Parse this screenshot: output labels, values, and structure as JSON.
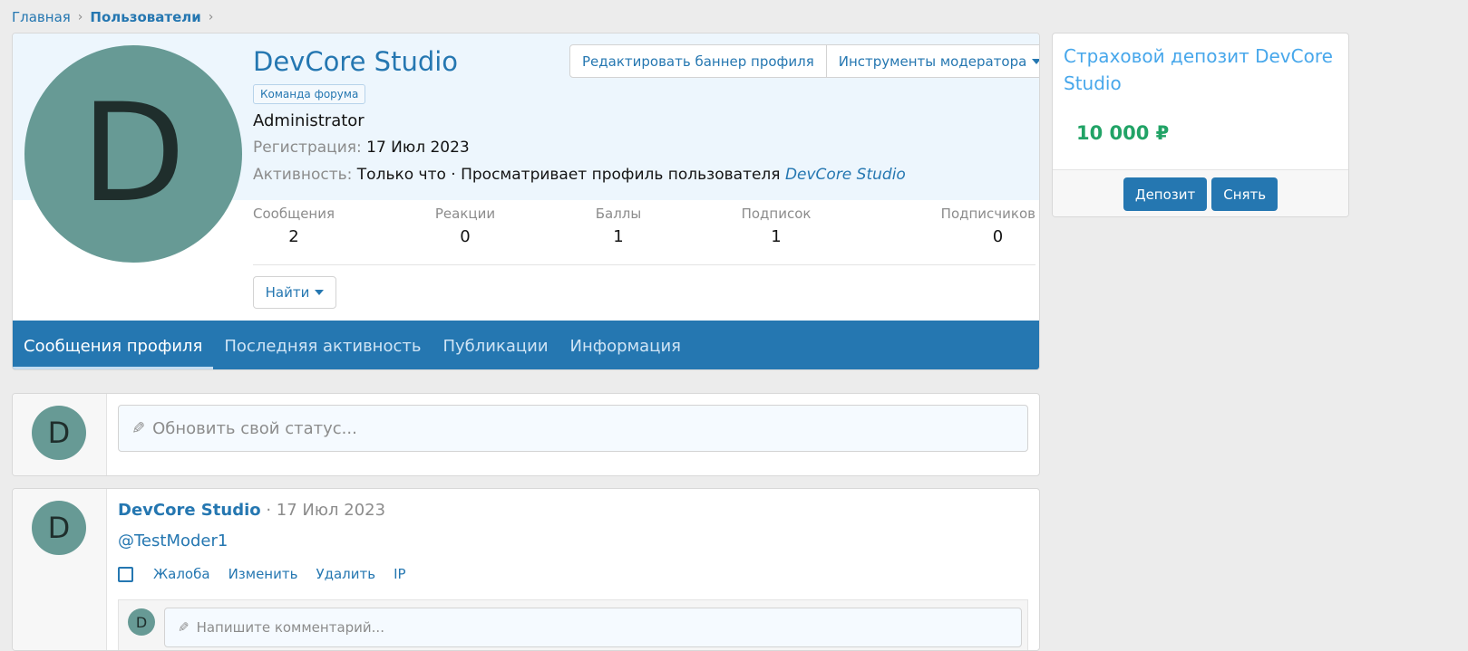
{
  "breadcrumb": {
    "home": "Главная",
    "current": "Пользователи",
    "separator": "›"
  },
  "profile": {
    "avatar_letter": "D",
    "name": "DevCore Studio",
    "banner": "Команда форума",
    "role": "Administrator",
    "registration_label": "Регистрация:",
    "registration_value": "17 Июл 2023",
    "activity_label": "Активность:",
    "activity_value": "Только что · Просматривает профиль пользователя",
    "activity_link": "DevCore Studio",
    "edit_banner_button": "Редактировать баннер профиля",
    "moderator_tools_button": "Инструменты модератора",
    "find_button": "Найти",
    "stats": [
      {
        "label": "Сообщения",
        "value": "2"
      },
      {
        "label": "Реакции",
        "value": "0"
      },
      {
        "label": "Баллы",
        "value": "1"
      },
      {
        "label": "Подписок",
        "value": "1"
      },
      {
        "label": "Подписчиков",
        "value": "0"
      }
    ],
    "tabs": [
      {
        "label": "Сообщения профиля",
        "active": true
      },
      {
        "label": "Последняя активность",
        "active": false
      },
      {
        "label": "Публикации",
        "active": false
      },
      {
        "label": "Информация",
        "active": false
      }
    ]
  },
  "status": {
    "avatar_letter": "D",
    "placeholder": "Обновить свой статус..."
  },
  "post": {
    "avatar_letter": "D",
    "author": "DevCore Studio",
    "date": " · 17 Июл 2023",
    "body": "@TestModer1",
    "actions": [
      "Жалоба",
      "Изменить",
      "Удалить",
      "IP"
    ],
    "comment_avatar_letter": "D",
    "comment_placeholder": "Напишите комментарий..."
  },
  "sidebar": {
    "title": "Страховой депозит DevCore Studio",
    "amount": "10 000 ₽",
    "deposit_button": "Депозит",
    "withdraw_button": "Снять"
  },
  "colors": {
    "accent": "#2577b1",
    "avatar": "#679a95",
    "amount": "#21a366"
  }
}
